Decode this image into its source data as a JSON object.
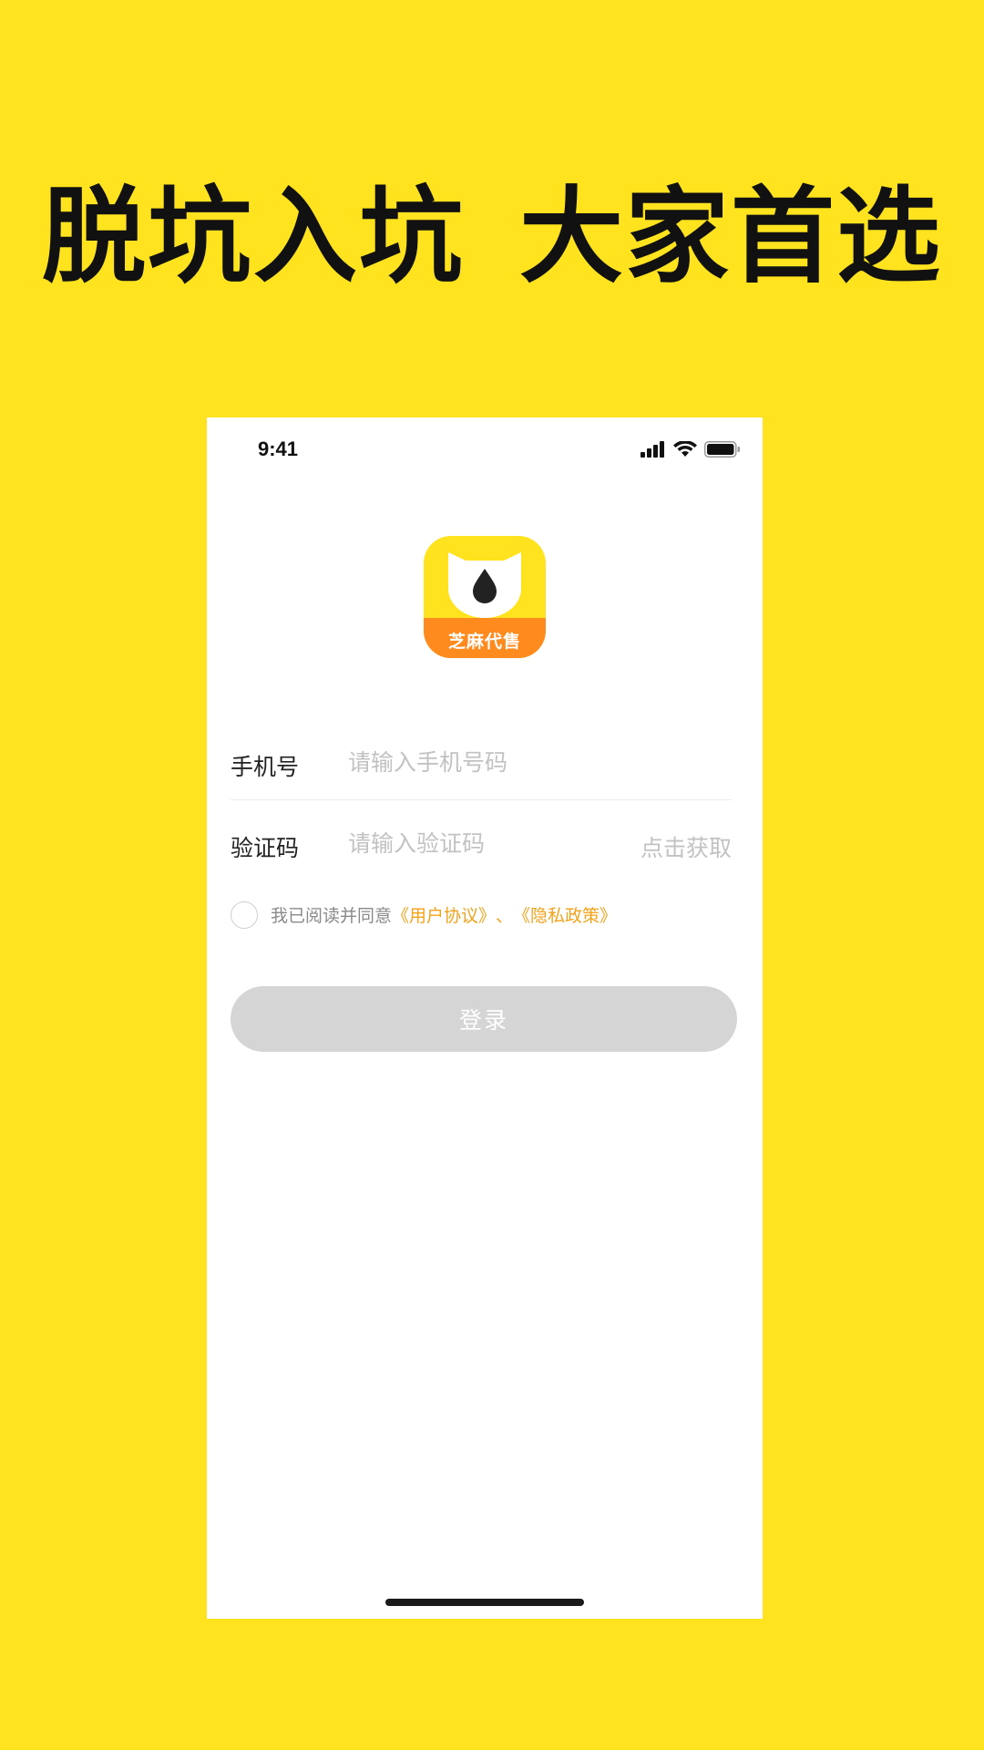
{
  "headline": {
    "part1": "脱坑入坑",
    "part2": "大家首选"
  },
  "status_bar": {
    "time": "9:41",
    "icons": [
      "cellular-signal-icon",
      "wifi-icon",
      "battery-icon"
    ]
  },
  "app": {
    "logo_text": "芝麻代售"
  },
  "form": {
    "phone_label": "手机号",
    "phone_placeholder": "请输入手机号码",
    "code_label": "验证码",
    "code_placeholder": "请输入验证码",
    "get_code_label": "点击获取"
  },
  "agreement": {
    "prefix": "我已阅读并同意",
    "user_agreement": "《用户协议》",
    "separator": "、",
    "privacy_policy": "《隐私政策》",
    "checked": false
  },
  "login_button": {
    "label": "登录"
  },
  "colors": {
    "background": "#ffe31e",
    "accent": "#f5a21b",
    "logo_band": "#ff8a1d",
    "button_disabled": "#d5d5d5"
  }
}
